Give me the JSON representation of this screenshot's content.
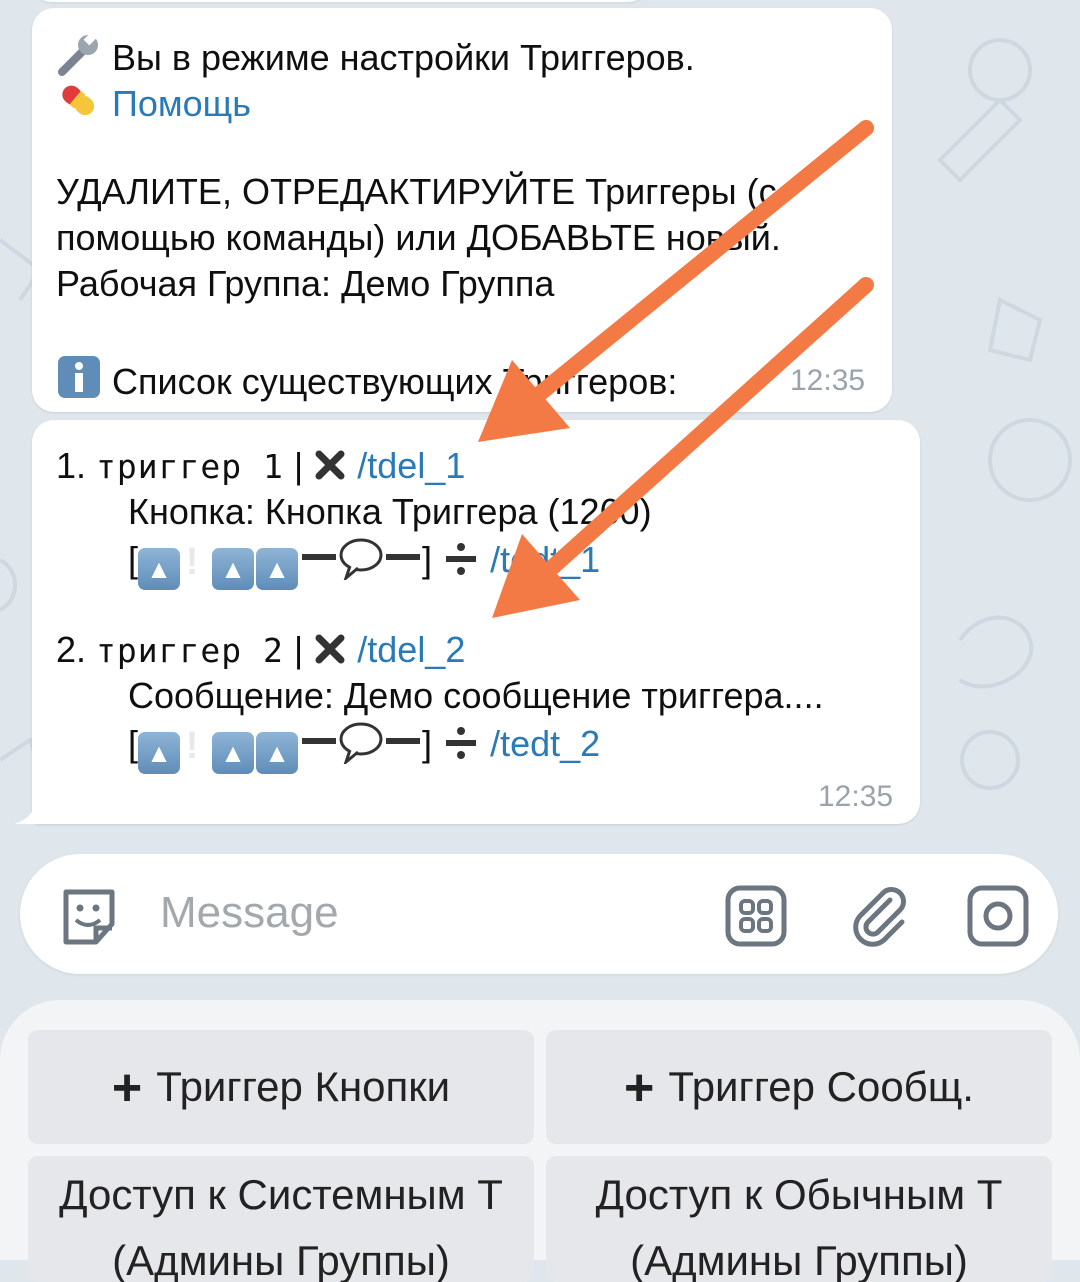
{
  "messages": [
    {
      "line1_text": "Вы в режиме настройки Триггеров.",
      "help_link": "Помощь",
      "line3": "УДАЛИТЕ, ОТРЕДАКТИРУЙТЕ Триггеры (с",
      "line4": "помощью команды) или ДОБАВЬТЕ новый.",
      "line5": "Рабочая Группа: Демо Группа",
      "list_header": "Список существующих Триггеров:",
      "time": "12:35"
    },
    {
      "triggers": [
        {
          "num": "1.",
          "name": "триггер 1",
          "sep": "|",
          "del_cmd": "/tdel_1",
          "detail": "Кнопка: Кнопка Триггера (1260)",
          "edit_cmd": "/tedt_1"
        },
        {
          "num": "2.",
          "name": "триггер 2",
          "sep": "|",
          "del_cmd": "/tdel_2",
          "detail": "Сообщение: Демо сообщение триггера....",
          "edit_cmd": "/tedt_2"
        }
      ],
      "time": "12:35"
    }
  ],
  "composer": {
    "placeholder": "Message"
  },
  "keyboard": {
    "btn1": "Триггер Кнопки",
    "btn2": "Триггер Сообщ.",
    "btn3": "Доступ к Системным Т",
    "btn4": "Доступ к Обычным Т",
    "btn3_line2": "(Админы Группы)",
    "btn4_line2": "(Админы Группы)"
  },
  "colors": {
    "link": "#2a7ab8",
    "arrow": "#f47a45",
    "background": "#dfe6ec",
    "bubble": "#ffffff"
  }
}
